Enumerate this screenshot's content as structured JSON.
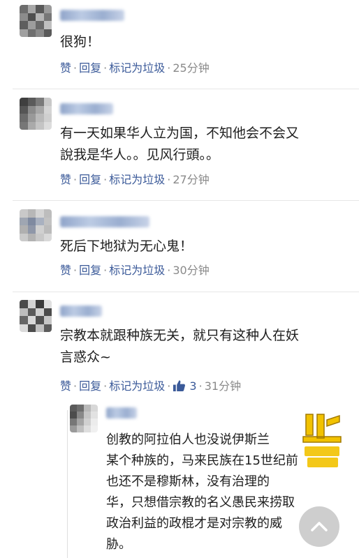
{
  "actions": {
    "like": "赞",
    "reply": "回复",
    "spam": "标记为垃圾"
  },
  "comments": [
    {
      "text": "很狗！",
      "time": "25分钟"
    },
    {
      "text": "有一天如果华人立为国，不知他会不会又",
      "text2": "說我是华人。。见风行頭。。",
      "time": "27分钟"
    },
    {
      "text": "死后下地狱为无心鬼！",
      "time": "30分钟"
    },
    {
      "text": "宗教本就跟种族无关，就只有这种人在妖",
      "text2": "言惑众~",
      "time": "31分钟",
      "likes": "3"
    }
  ],
  "reply": {
    "lines": [
      "创教的阿拉伯人也没说伊斯兰",
      "某个种族的，马来民族在15世纪前",
      "也还不是穆斯林，没有治理的",
      "华，只想借宗教的名义愚民来捞取",
      "政治利益的政棍才是对宗教的威",
      "胁。"
    ]
  },
  "colors": {
    "link": "#3b5a99",
    "muted": "#8a8a8a",
    "watermark": "#e8b400"
  },
  "icons": {
    "like": "thumbs-up-icon",
    "scroll": "chevron-up-icon"
  }
}
